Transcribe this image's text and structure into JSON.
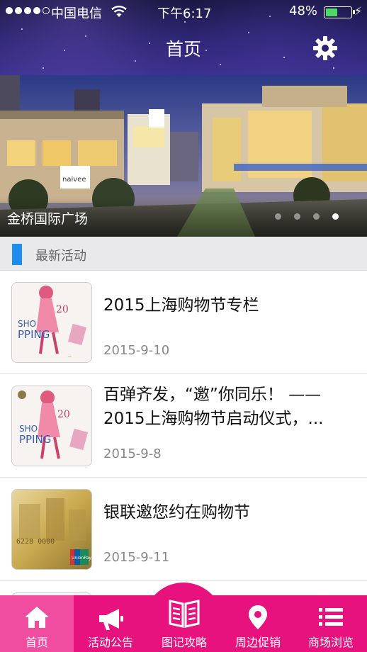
{
  "status_bar": {
    "carrier": "中国电信",
    "time": "下午6:17",
    "battery_percent": "48%",
    "battery_level": 0.48
  },
  "nav": {
    "title": "首页",
    "settings_icon": "gear-icon"
  },
  "banner": {
    "caption": "金桥国际广场",
    "store_sign": "naivee",
    "page_count": 4,
    "active_page": 4
  },
  "section": {
    "title": "最新活动",
    "accent_color": "#1f8cf0"
  },
  "list": [
    {
      "title": "2015上海购物节专栏",
      "date": "2015-9-10",
      "thumb_icon": "shopping-festival-poster"
    },
    {
      "title": "百弹齐发，“邀”你同乐！ ——2015上海购物节启动仪式，...",
      "date": "2015-9-8",
      "thumb_icon": "shopping-festival-poster"
    },
    {
      "title": "银联邀您约在购物节",
      "date": "2015-9-11",
      "thumb_icon": "unionpay-card"
    }
  ],
  "tabbar": {
    "color": "#e8127f",
    "items": [
      {
        "label": "首页",
        "icon": "home-icon",
        "active": true
      },
      {
        "label": "活动公告",
        "icon": "megaphone-icon",
        "active": false
      },
      {
        "label": "图记攻略",
        "icon": "book-icon",
        "active": false
      },
      {
        "label": "周边促销",
        "icon": "location-pin-icon",
        "active": false
      },
      {
        "label": "商场浏览",
        "icon": "list-icon",
        "active": false
      }
    ]
  }
}
